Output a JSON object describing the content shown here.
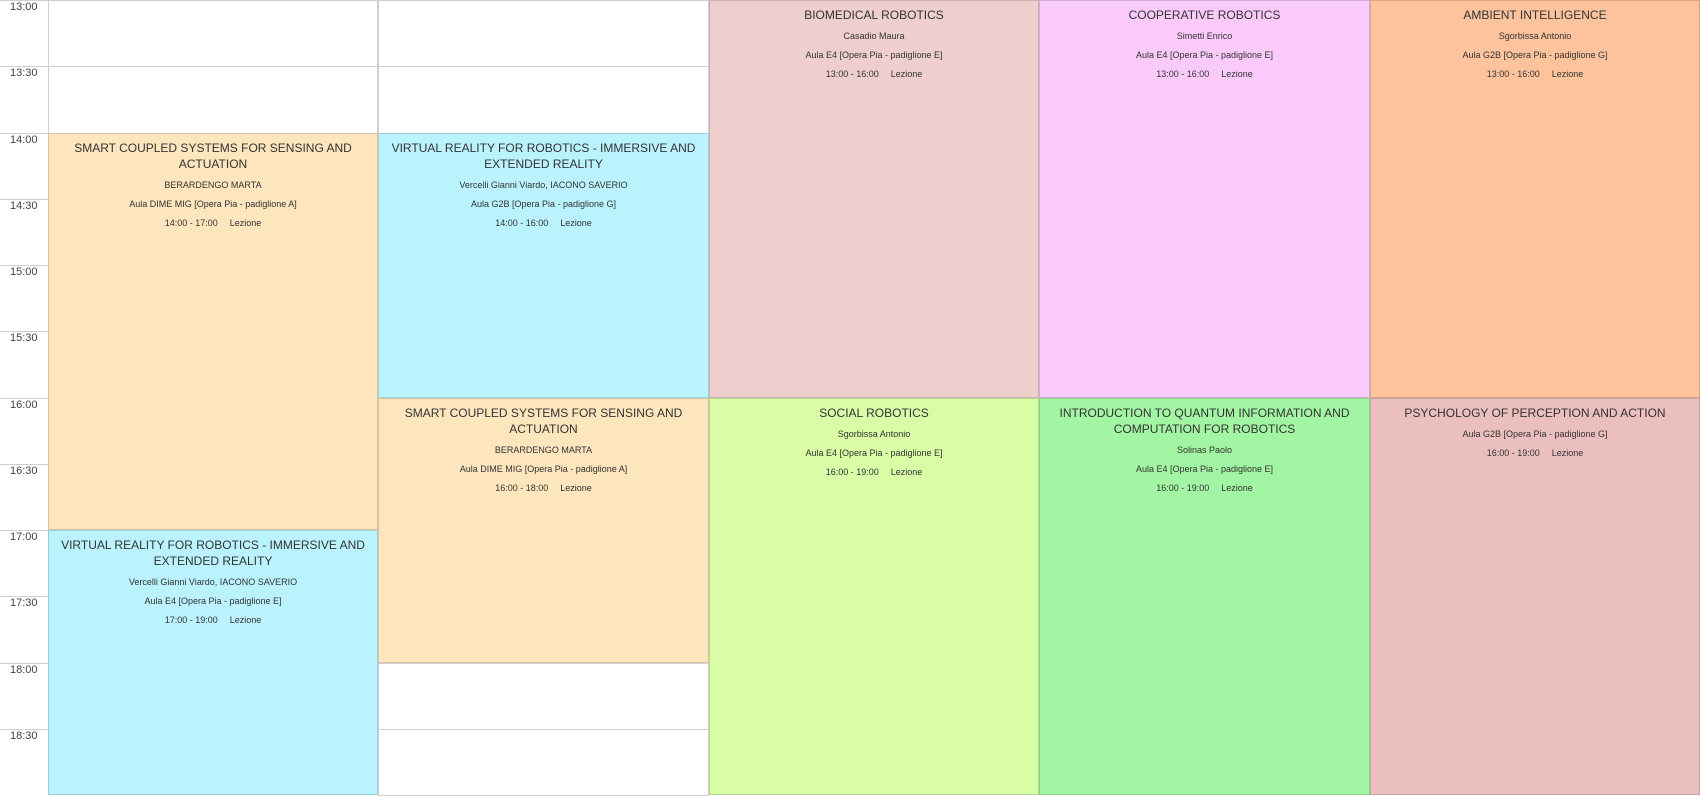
{
  "times": [
    "13:00",
    "13:30",
    "14:00",
    "14:30",
    "15:00",
    "15:30",
    "16:00",
    "16:30",
    "17:00",
    "17:30",
    "18:00",
    "18:30"
  ],
  "events": [
    {
      "title": "SMART COUPLED SYSTEMS FOR SENSING AND ACTUATION",
      "teacher": "BERARDENGO MARTA",
      "room": "Aula DIME MIG [Opera Pia - padiglione A]",
      "time": "14:00 - 17:00",
      "type": "Lezione",
      "color": "#fde5bd"
    },
    {
      "title": "VIRTUAL REALITY FOR ROBOTICS - IMMERSIVE AND EXTENDED REALITY",
      "teacher": "Vercelli Gianni Viardo, IACONO SAVERIO",
      "room": "Aula E4 [Opera Pia - padiglione E]",
      "time": "17:00 - 19:00",
      "type": "Lezione",
      "color": "#baf3fd"
    },
    {
      "title": "VIRTUAL REALITY FOR ROBOTICS - IMMERSIVE AND EXTENDED REALITY",
      "teacher": "Vercelli Gianni Viardo, IACONO SAVERIO",
      "room": "Aula G2B [Opera Pia - padiglione G]",
      "time": "14:00 - 16:00",
      "type": "Lezione",
      "color": "#baf3fd"
    },
    {
      "title": "SMART COUPLED SYSTEMS FOR SENSING AND ACTUATION",
      "teacher": "BERARDENGO MARTA",
      "room": "Aula DIME MIG [Opera Pia - padiglione A]",
      "time": "16:00 - 18:00",
      "type": "Lezione",
      "color": "#fde5bd"
    },
    {
      "title": "BIOMEDICAL ROBOTICS",
      "teacher": "Casadio Maura",
      "room": "Aula E4 [Opera Pia - padiglione E]",
      "time": "13:00 - 16:00",
      "type": "Lezione",
      "color": "#eecfcd"
    },
    {
      "title": "SOCIAL ROBOTICS",
      "teacher": "Sgorbissa Antonio",
      "room": "Aula E4 [Opera Pia - padiglione E]",
      "time": "16:00 - 19:00",
      "type": "Lezione",
      "color": "#d8fda6"
    },
    {
      "title": "COOPERATIVE ROBOTICS",
      "teacher": "Simetti Enrico",
      "room": "Aula E4 [Opera Pia - padiglione E]",
      "time": "13:00 - 16:00",
      "type": "Lezione",
      "color": "#facbfa"
    },
    {
      "title": "INTRODUCTION TO QUANTUM INFORMATION AND COMPUTATION FOR ROBOTICS",
      "teacher": "Solinas Paolo",
      "room": "Aula E4 [Opera Pia - padiglione E]",
      "time": "16:00 - 19:00",
      "type": "Lezione",
      "color": "#a2f5a2"
    },
    {
      "title": "AMBIENT INTELLIGENCE",
      "teacher": "Sgorbissa Antonio",
      "room": "Aula G2B [Opera Pia - padiglione G]",
      "time": "13:00 - 16:00",
      "type": "Lezione",
      "color": "#fdc39d"
    },
    {
      "title": "PSYCHOLOGY OF PERCEPTION AND ACTION",
      "teacher": "",
      "room": "Aula G2B [Opera Pia - padiglione G]",
      "time": "16:00 - 19:00",
      "type": "Lezione",
      "color": "#ecbfbf"
    }
  ]
}
